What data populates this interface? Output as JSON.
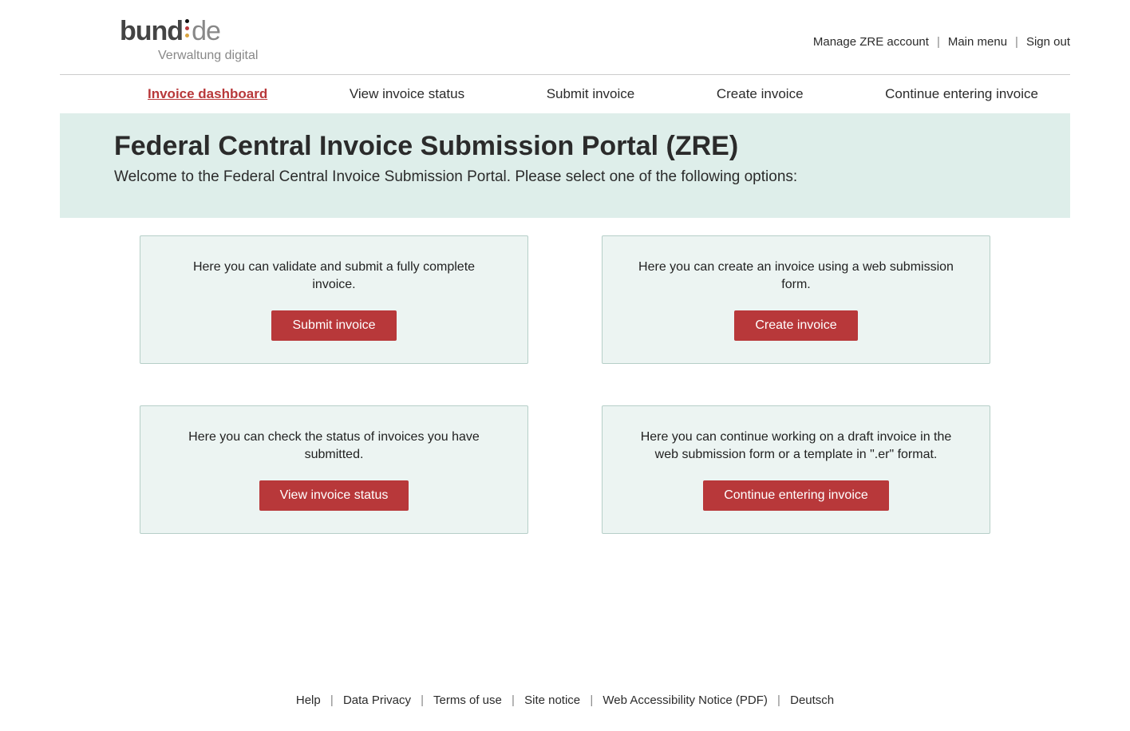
{
  "logo": {
    "word1": "bund",
    "word2": "de",
    "subtitle": "Verwaltung digital"
  },
  "top_links": {
    "manage": "Manage ZRE account",
    "main_menu": "Main menu",
    "sign_out": "Sign out"
  },
  "nav": {
    "dashboard": "Invoice dashboard",
    "view_status": "View invoice status",
    "submit": "Submit invoice",
    "create": "Create invoice",
    "continue": "Continue entering invoice"
  },
  "banner": {
    "title": "Federal Central Invoice Submission Portal (ZRE)",
    "subtitle": "Welcome to the Federal Central Invoice Submission Portal. Please select one of the following options:"
  },
  "cards": {
    "submit": {
      "text": "Here you can validate and submit a fully complete invoice.",
      "button": "Submit invoice"
    },
    "create": {
      "text": "Here you can create an invoice using a web submission form.",
      "button": "Create invoice"
    },
    "status": {
      "text": "Here you can check the status of invoices you have submitted.",
      "button": "View invoice status"
    },
    "continue": {
      "text": "Here you can continue working on a draft invoice in the web submission form or a template in \".er\" format.",
      "button": "Continue entering invoice"
    }
  },
  "footer": {
    "help": "Help",
    "privacy": "Data Privacy",
    "terms": "Terms of use",
    "site_notice": "Site notice",
    "accessibility": "Web Accessibility Notice (PDF)",
    "lang": "Deutsch"
  }
}
